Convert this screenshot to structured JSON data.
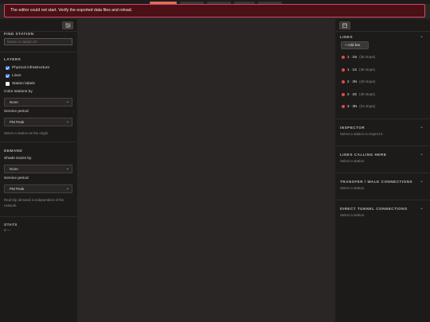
{
  "error": {
    "message": "The editor could not start. Verify the exported data files and reload."
  },
  "left": {
    "find_station": {
      "title": "FIND STATION",
      "placeholder": "Name or station ID"
    },
    "layers": {
      "title": "LAYERS",
      "items": [
        {
          "label": "Physical infrastructure",
          "checked": true
        },
        {
          "label": "Lines",
          "checked": true
        },
        {
          "label": "Station labels",
          "checked": false
        }
      ],
      "color_by_label": "Color stations by",
      "color_by_value": "None",
      "service_label": "Service period",
      "service_value": "PM Peak",
      "hint": "Select a station as the origin."
    },
    "demand": {
      "title": "DEMAND",
      "shade_label": "Shade tracks by",
      "shade_value": "None",
      "service_label": "Service period",
      "service_value": "PM Peak",
      "hint": "Real trip demand is independent of the network."
    },
    "stats": {
      "title": "STATS",
      "value": "0 —"
    }
  },
  "right": {
    "lines": {
      "title": "LINES",
      "add_label": "+ Add line",
      "items": [
        {
          "name": "1 · 1N",
          "stops": "(36 stops)",
          "color": "#e04a4a"
        },
        {
          "name": "1 · 1S",
          "stops": "(36 stops)",
          "color": "#e04a4a"
        },
        {
          "name": "2 · 2N",
          "stops": "(49 stops)",
          "color": "#e04a4a"
        },
        {
          "name": "2 · 2S",
          "stops": "(49 stops)",
          "color": "#e04a4a"
        },
        {
          "name": "3 · 3N",
          "stops": "(34 stops)",
          "color": "#e04a4a"
        }
      ]
    },
    "inspector": {
      "title": "INSPECTOR",
      "hint": "Select a station to inspect it."
    },
    "calling": {
      "title": "LINES CALLING HERE",
      "hint": "Select a station."
    },
    "transfer": {
      "title": "TRANSFER / WALK CONNECTIONS",
      "hint": "Select a station."
    },
    "tunnel": {
      "title": "DIRECT TUNNEL CONNECTIONS",
      "hint": "Select a station."
    }
  },
  "icons": {
    "filter": "sliders-icon",
    "calendar": "calendar-icon",
    "chevron": "chevron-down-icon"
  },
  "colors": {
    "error_bg": "#4a1016",
    "error_border": "#d04a6a",
    "accent": "#e06e54",
    "line_dot": "#e04a4a"
  }
}
